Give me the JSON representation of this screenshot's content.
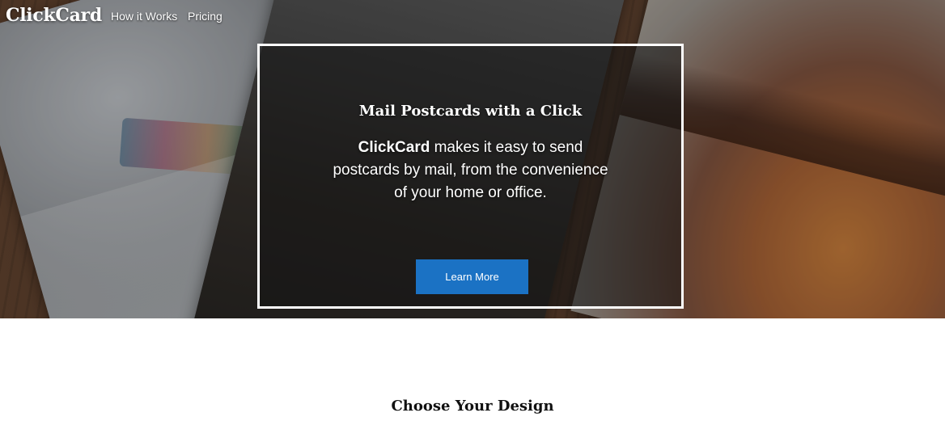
{
  "nav": {
    "brand": "ClickCard",
    "links": [
      "How it Works",
      "Pricing"
    ]
  },
  "hero": {
    "title": "Mail Postcards with a Click",
    "text_brand": "ClickCard",
    "text_rest": " makes it easy to send postcards by mail, from the convenience of your home or office.",
    "button_label": "Learn More",
    "button_color": "#1b72c4"
  },
  "section": {
    "title": "Choose Your Design"
  }
}
